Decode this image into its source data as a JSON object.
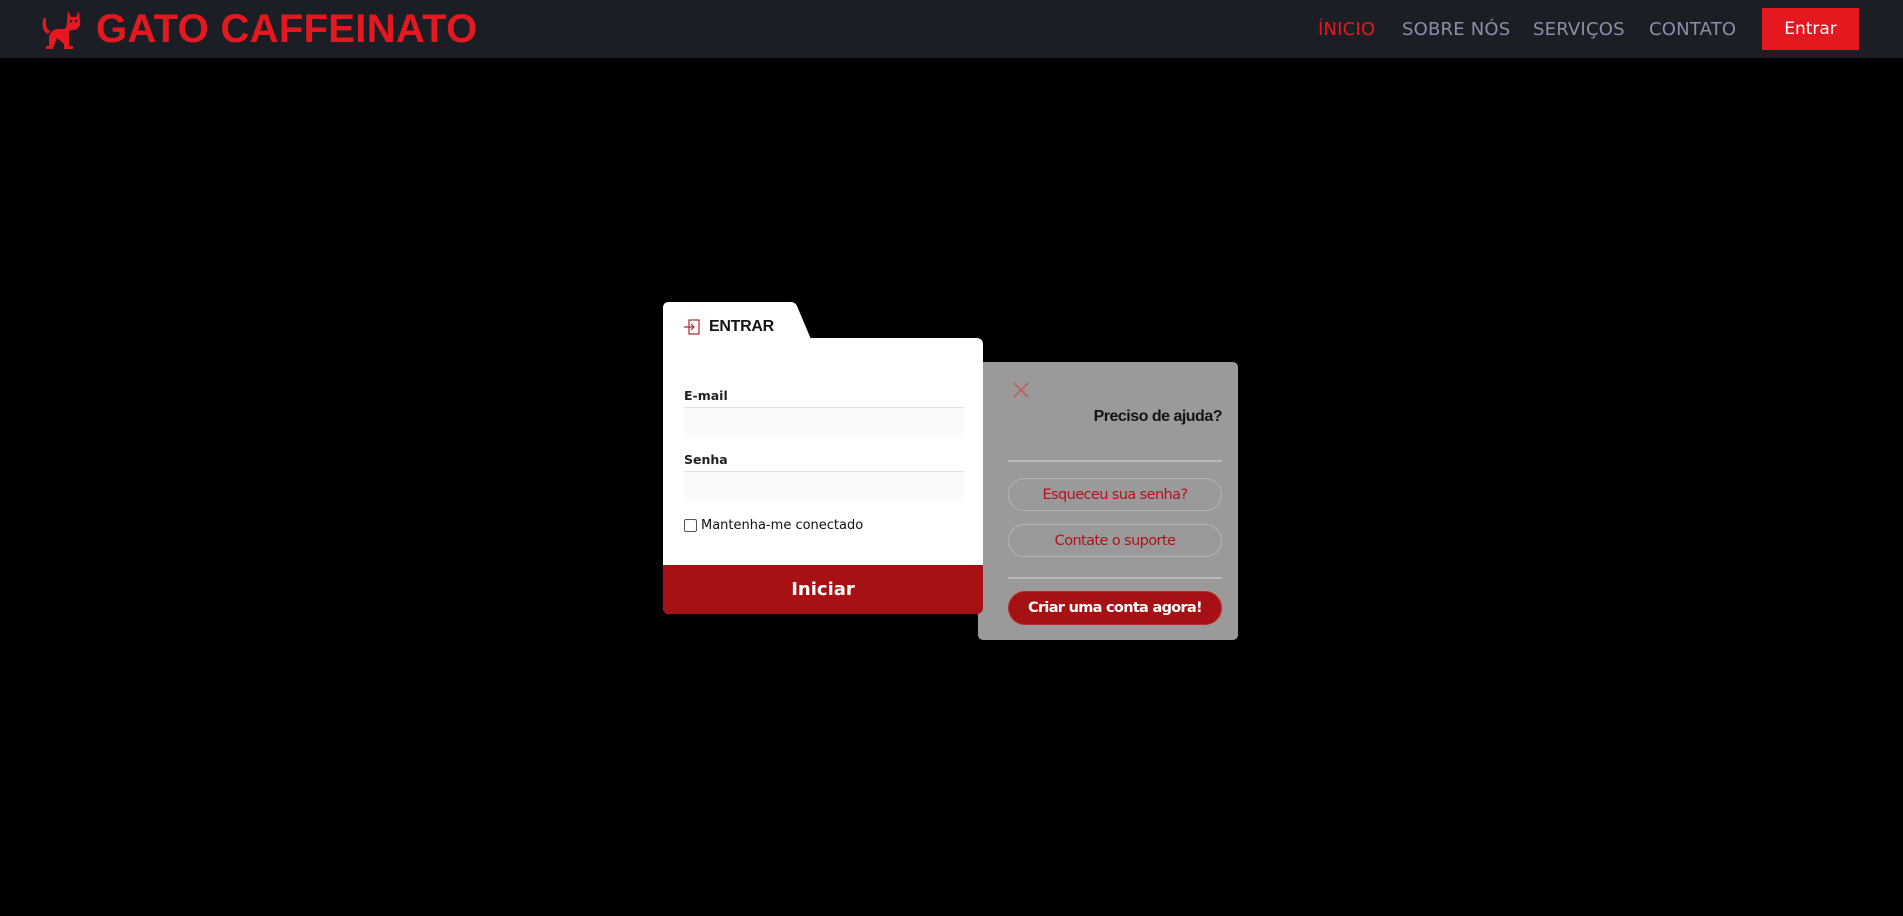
{
  "header": {
    "brand": "GATO CAFFEINATO",
    "brand_icon": "cat-icon",
    "nav": [
      "ÍNICIO",
      "SOBRE NÓS",
      "SERVIÇOS",
      "CONTATO"
    ],
    "active_nav": "ÍNICIO",
    "login_button": "Entrar"
  },
  "login": {
    "tab_icon": "login-icon",
    "tab_title": "ENTRAR",
    "email_label": "E-mail",
    "email_value": "",
    "password_label": "Senha",
    "password_value": "",
    "remember_label": "Mantenha-me conectado",
    "remember_checked": false,
    "submit": "Iniciar"
  },
  "help": {
    "close_icon": "close-icon",
    "title": "Preciso de ajuda?",
    "forgot_password": "Esqueceu sua senha?",
    "contact_support": "Contate o suporte",
    "create_account": "Criar uma conta agora!"
  },
  "colors": {
    "accent_red": "#e5181f",
    "dark_red": "#a81114",
    "header_bg": "#1c1e26",
    "nav_text": "#8b8ea8",
    "page_bg": "#000000",
    "help_panel_bg": "#9a9a9a"
  }
}
